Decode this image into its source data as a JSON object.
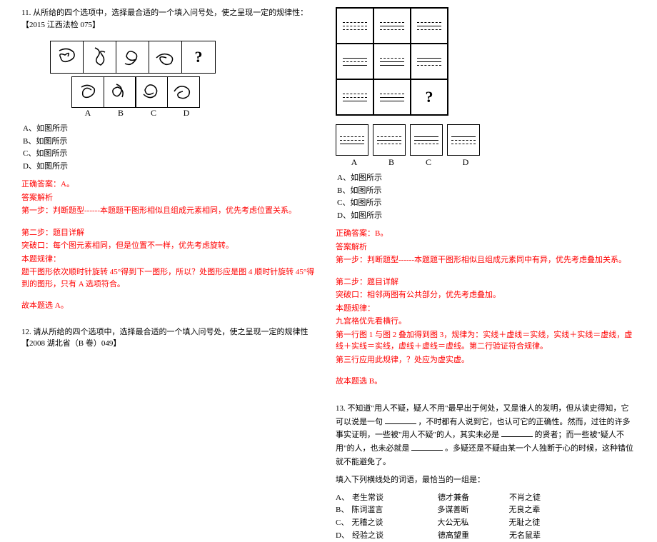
{
  "q11": {
    "title": "11. 从所给的四个选项中，选择最合适的一个填入问号处，使之呈现一定的规律性：【2015 江西法检 075】",
    "options": {
      "A": "A、如图所示",
      "B": "B、如图所示",
      "C": "C、如图所示",
      "D": "D、如图所示"
    },
    "labelA": "A",
    "labelB": "B",
    "labelC": "C",
    "labelD": "D",
    "qmark": "?",
    "answer": "正确答案：A。",
    "a1": "答案解析",
    "a2": "第一步：判断题型------本题题干图形相似且组成元素相同，优先考虑位置关系。",
    "a3": "第二步：题目详解",
    "a4": "突破口：每个图元素相同，但是位置不一样，优先考虑旋转。",
    "a5": "本题规律：",
    "a6": "题干图形依次顺时针旋转 45°得到下一图形，所以？处图形应是图 4 顺时针旋转 45°得到的图形，只有 A 选项符合。",
    "a7": "故本题选 A。"
  },
  "q12": {
    "title": "12. 请从所给的四个选项中，选择最合适的一个填入问号处，使之呈现一定的规律性【2008 湖北省（B 卷）049】",
    "options": {
      "A": "A、如图所示",
      "B": "B、如图所示",
      "C": "C、如图所示",
      "D": "D、如图所示"
    },
    "labelA": "A",
    "labelB": "B",
    "labelC": "C",
    "labelD": "D",
    "qmark": "?",
    "answer": "正确答案：B。",
    "a1": "答案解析",
    "a2": "第一步：判断题型------本题题干图形相似且组成元素同中有异，优先考虑叠加关系。",
    "a3": "第二步：题目详解",
    "a4": "突破口：相邻两图有公共部分，优先考虑叠加。",
    "a5": "本题规律：",
    "a6": "九宫格优先看横行。",
    "a7": "第一行图 1 与图 2 叠加得到图 3，规律为：实线＋虚线＝实线，实线＋实线＝虚线，虚线＋实线＝实线，虚线＋虚线＝虚线。第二行验证符合规律。",
    "a8": "第三行应用此规律，？处应为虚实虚。",
    "a9": "故本题选 B。"
  },
  "q13": {
    "title_p1": "13. 不知道\"用人不疑，疑人不用\"最早出于何处，又是谁人的发明，但从读史得知，它可以说是一句",
    "title_p2": "，不时都有人说到它，也认可它的正确性。然而，过往的许多事实证明，一些被\"用人不疑\"的人，其实未必是",
    "title_p3": "的贤者；而一些被\"疑人不用\"的人，也未必就是",
    "title_p4": "。多疑还是不疑由某一个人独断于心的时候，这种错位就不能避免了。",
    "title_p5": "填入下列横线处的词语，最恰当的一组是：",
    "optA": {
      "l": "A、",
      "c1": "老生常谈",
      "c2": "德才兼备",
      "c3": "不肖之徒"
    },
    "optB": {
      "l": "B、",
      "c1": "陈词滥言",
      "c2": "多谋善断",
      "c3": "无良之辈"
    },
    "optC": {
      "l": "C、",
      "c1": "无稽之谈",
      "c2": "大公无私",
      "c3": "无耻之徒"
    },
    "optD": {
      "l": "D、",
      "c1": "经验之谈",
      "c2": "德高望重",
      "c3": "无名鼠辈"
    }
  }
}
